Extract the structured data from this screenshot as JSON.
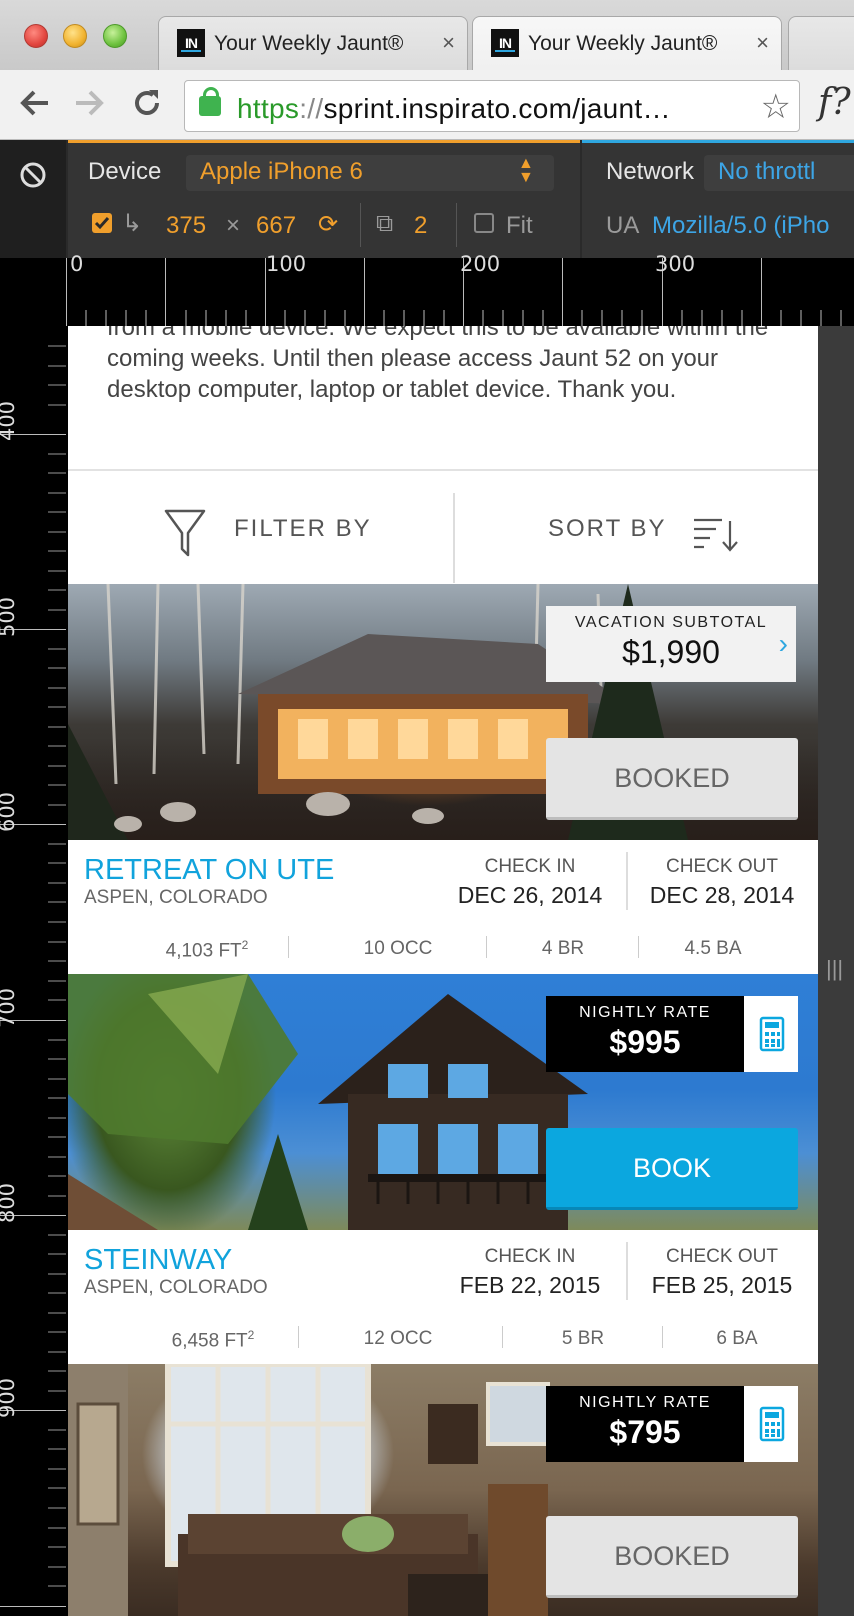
{
  "browser": {
    "tabs": [
      {
        "favicon": "IN",
        "title": "Your Weekly Jaunt®",
        "close": "×"
      },
      {
        "favicon": "IN",
        "title": "Your Weekly Jaunt®",
        "close": "×"
      }
    ],
    "url": {
      "scheme": "https",
      "sep": "://",
      "rest": "sprint.inspirato.com/jaunt…"
    },
    "extension": "f?"
  },
  "devtools": {
    "device_label": "Device",
    "device_value": "Apple iPhone 6",
    "width": "375",
    "times": "×",
    "height": "667",
    "pixel_ratio": "2",
    "fit_label": "Fit",
    "network_label": "Network",
    "network_value": "No throttl",
    "ua_label": "UA",
    "ua_value": "Mozilla/5.0 (iPho"
  },
  "ruler": {
    "top": [
      "0",
      "100",
      "200",
      "300"
    ],
    "left": [
      "400",
      "500",
      "600",
      "700",
      "800",
      "900"
    ]
  },
  "page": {
    "notice": "from a mobile device. We expect this to be available within the coming weeks. Until then please access Jaunt 52 on your desktop computer, laptop or tablet device. Thank you.",
    "filter_label": "FILTER BY",
    "sort_label": "SORT BY",
    "listings": [
      {
        "price_label": "VACATION SUBTOTAL",
        "price": "$1,990",
        "button": "BOOKED",
        "name": "RETREAT ON UTE",
        "location": "ASPEN, COLORADO",
        "checkin_label": "CHECK IN",
        "checkin": "DEC 26, 2014",
        "checkout_label": "CHECK OUT",
        "checkout": "DEC 28, 2014",
        "sqft": "4,103 FT",
        "sqft_sup": "2",
        "occ": "10 OCC",
        "br": "4 BR",
        "ba": "4.5 BA"
      },
      {
        "price_label": "NIGHTLY RATE",
        "price": "$995",
        "button": "BOOK",
        "name": "STEINWAY",
        "location": "ASPEN, COLORADO",
        "checkin_label": "CHECK IN",
        "checkin": "FEB 22, 2015",
        "checkout_label": "CHECK OUT",
        "checkout": "FEB 25, 2015",
        "sqft": "6,458 FT",
        "sqft_sup": "2",
        "occ": "12 OCC",
        "br": "5 BR",
        "ba": "6 BA"
      },
      {
        "price_label": "NIGHTLY RATE",
        "price": "$795",
        "button": "BOOKED"
      }
    ]
  },
  "colors": {
    "accent": "#0ba7df",
    "devtools_orange": "#f09f2c",
    "devtools_blue": "#3da5e6"
  }
}
